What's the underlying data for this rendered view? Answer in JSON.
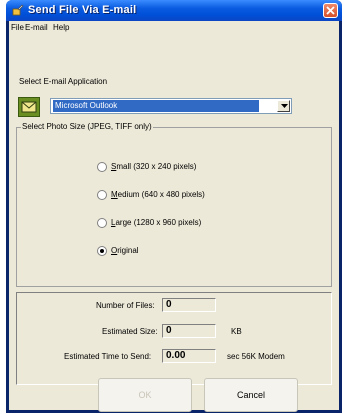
{
  "window": {
    "title": "Send File Via E-mail"
  },
  "menu": {
    "items": [
      "File",
      "E-mail",
      "Help"
    ]
  },
  "app_section": {
    "label": "Select E-mail Application",
    "selected_app": "Microsoft Outlook"
  },
  "photo_size": {
    "title": "Select Photo Size (JPEG, TIFF only)",
    "options": [
      {
        "prefix": "",
        "mnemonic": "S",
        "rest": "mall (320 x 240 pixels)",
        "checked": false
      },
      {
        "prefix": "",
        "mnemonic": "M",
        "rest": "edium (640 x 480 pixels)",
        "checked": false
      },
      {
        "prefix": "",
        "mnemonic": "L",
        "rest": "arge (1280 x 960 pixels)",
        "checked": false
      },
      {
        "prefix": "",
        "mnemonic": "O",
        "rest": "riginal",
        "checked": true
      }
    ]
  },
  "stats": {
    "num_files_label": "Number of Files:",
    "num_files_value": "0",
    "est_size_label": "Estimated Size:",
    "est_size_value": "0",
    "est_size_unit": "KB",
    "est_time_label": "Estimated Time to Send:",
    "est_time_value": "0.00",
    "est_time_unit": "sec 56K Modem"
  },
  "buttons": {
    "ok": "OK",
    "cancel": "Cancel"
  }
}
